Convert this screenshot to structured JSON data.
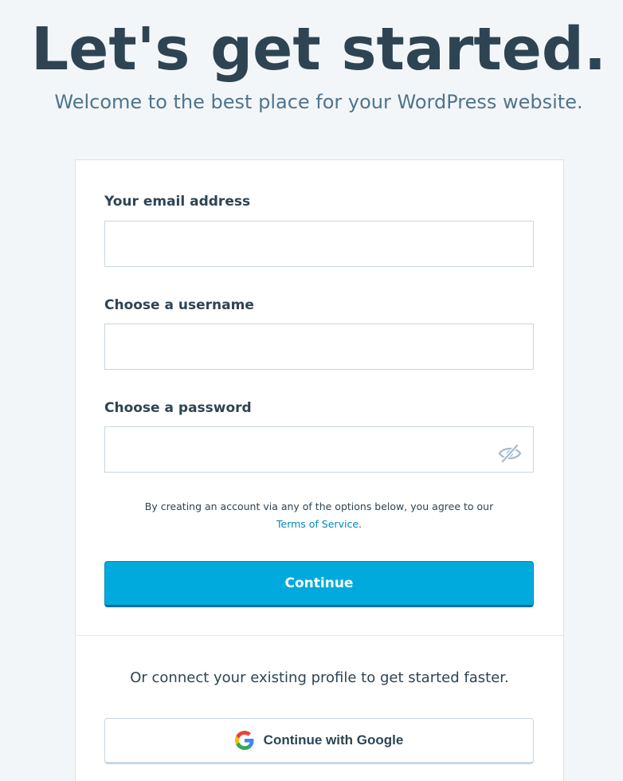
{
  "header": {
    "title": "Let's get started.",
    "subtitle": "Welcome to the best place for your WordPress website."
  },
  "form": {
    "email": {
      "label": "Your email address",
      "value": "",
      "placeholder": ""
    },
    "username": {
      "label": "Choose a username",
      "value": "",
      "placeholder": ""
    },
    "password": {
      "label": "Choose a password",
      "value": "",
      "placeholder": ""
    },
    "password_toggle_icon": "eye-slash-icon",
    "terms_prefix": "By creating an account via any of the options below, you agree to our",
    "terms_link": "Terms of Service",
    "terms_suffix": ".",
    "continue_label": "Continue"
  },
  "social": {
    "prompt": "Or connect your existing profile to get started faster.",
    "google_label": "Continue with Google",
    "google_icon": "google-logo-icon"
  },
  "colors": {
    "background": "#f3f6f8",
    "primary": "#00aadc",
    "link": "#0087be",
    "text": "#2e4453"
  }
}
